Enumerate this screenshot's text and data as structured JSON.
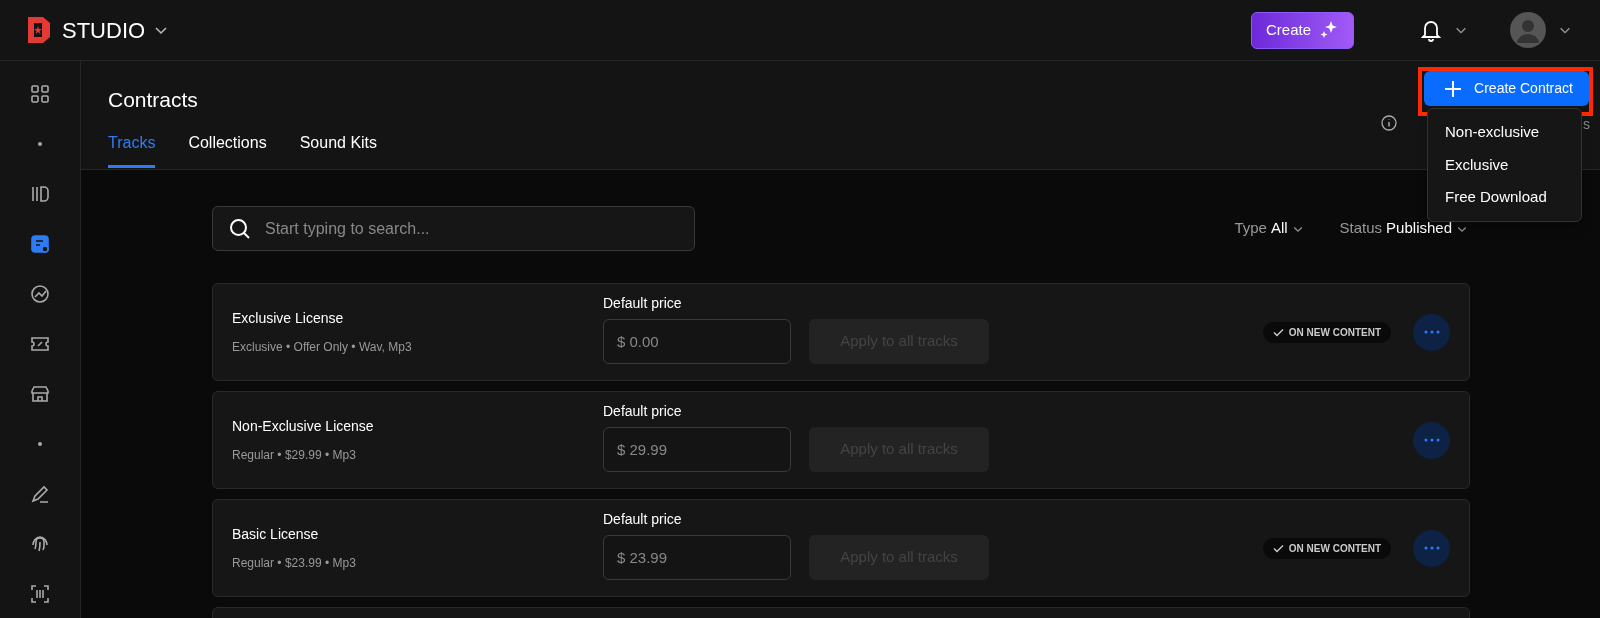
{
  "brand": {
    "name": "STUDIO"
  },
  "topbar": {
    "create_button": "Create"
  },
  "sidebar": {
    "items": [
      {
        "kind": "grid",
        "selected": false
      },
      {
        "kind": "dot",
        "selected": false
      },
      {
        "kind": "library",
        "selected": false
      },
      {
        "kind": "contracts",
        "selected": true
      },
      {
        "kind": "chart",
        "selected": false
      },
      {
        "kind": "ticket",
        "selected": false
      },
      {
        "kind": "store",
        "selected": false
      },
      {
        "kind": "dot",
        "selected": false
      },
      {
        "kind": "pen",
        "selected": false
      },
      {
        "kind": "fingerprint",
        "selected": false
      },
      {
        "kind": "scan",
        "selected": false
      }
    ]
  },
  "page": {
    "title": "Contracts",
    "create_contract": "Create Contract",
    "hidden_text_end": "s"
  },
  "tabs": [
    {
      "label": "Tracks",
      "selected": true
    },
    {
      "label": "Collections",
      "selected": false
    },
    {
      "label": "Sound Kits",
      "selected": false
    }
  ],
  "menu": [
    "Non-exclusive",
    "Exclusive",
    "Free Download"
  ],
  "search": {
    "placeholder": "Start typing to search..."
  },
  "filters": [
    {
      "label": "Type",
      "value": "All"
    },
    {
      "label": "Status",
      "value": "Published"
    }
  ],
  "contracts": [
    {
      "name": "Exclusive License",
      "details": "Exclusive • Offer Only • Wav, Mp3",
      "price_label": "Default price",
      "price": "$ 0.00",
      "apply": "Apply to all tracks",
      "badge": "ON NEW CONTENT"
    },
    {
      "name": "Non-Exclusive License",
      "details": "Regular • $29.99 • Mp3",
      "price_label": "Default price",
      "price": "$ 29.99",
      "apply": "Apply to all tracks"
    },
    {
      "name": "Basic License",
      "details": "Regular • $23.99 • Mp3",
      "price_label": "Default price",
      "price": "$ 23.99",
      "apply": "Apply to all tracks",
      "badge": "ON NEW CONTENT"
    }
  ]
}
